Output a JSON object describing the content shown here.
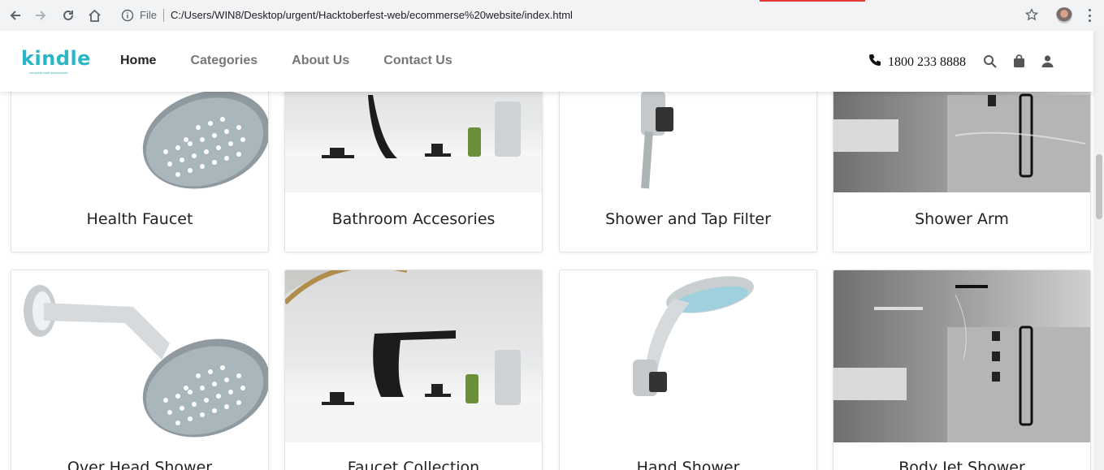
{
  "browser": {
    "file_label": "File",
    "url": "C:/Users/WIN8/Desktop/urgent/Hacktoberfest-web/ecommerse%20website/index.html"
  },
  "header": {
    "logo_text": "kindle",
    "logo_tagline": "complete bath accessories",
    "nav": [
      "Home",
      "Categories",
      "About Us",
      "Contact Us"
    ],
    "phone": "1800 233 8888"
  },
  "products_row1": [
    "Health Faucet",
    "Bathroom Accesories",
    "Shower and Tap Filter",
    "Shower Arm"
  ],
  "products_row2": [
    "Over Head Shower",
    "Faucet Collection",
    "Hand Shower",
    "Body Jet Shower"
  ],
  "colors": {
    "brand": "#29b6c7",
    "nav_active": "#222222",
    "nav_inactive": "#777777"
  }
}
